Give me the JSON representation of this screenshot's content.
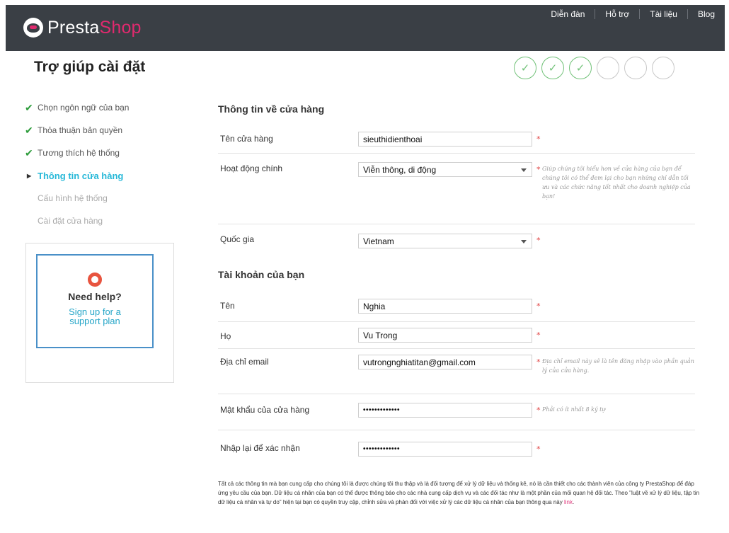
{
  "header": {
    "logo_part1": "Presta",
    "logo_part2": "Shop",
    "nav": [
      "Diễn đàn",
      "Hỗ trợ",
      "Tài liệu",
      "Blog"
    ]
  },
  "page": {
    "title": "Trợ giúp cài đặt"
  },
  "progress": {
    "total_steps": 6,
    "completed_steps": 3
  },
  "sidebar": {
    "items": [
      {
        "label": "Chọn ngôn ngữ của bạn",
        "state": "done"
      },
      {
        "label": "Thỏa thuận bản quyền",
        "state": "done"
      },
      {
        "label": "Tương thích hệ thống",
        "state": "done"
      },
      {
        "label": "Thông tin cửa hàng",
        "state": "active"
      },
      {
        "label": "Cấu hình hệ thống",
        "state": "pending"
      },
      {
        "label": "Cài đặt cửa hàng",
        "state": "pending"
      }
    ]
  },
  "help": {
    "title": "Need help?",
    "link_line1": "Sign up for a",
    "link_line2": "support plan"
  },
  "store": {
    "section_title": "Thông tin về cửa hàng",
    "name_label": "Tên cửa hàng",
    "name_value": "sieuthidienthoai",
    "activity_label": "Hoạt động chính",
    "activity_value": "Viễn thông, di động",
    "activity_hint": "Giúp chúng tôi hiểu hơn về cửa hàng của bạn để chúng tôi có thể đem lại cho bạn những chỉ dẫn tối ưu và các chức năng tốt nhất cho doanh nghiệp của bạn!",
    "country_label": "Quốc gia",
    "country_value": "Vietnam"
  },
  "account": {
    "section_title": "Tài khoản của bạn",
    "first_name_label": "Tên",
    "first_name_value": "Nghia",
    "last_name_label": "Họ",
    "last_name_value": "Vu Trong",
    "email_label": "Địa chỉ email",
    "email_value": "vutrongnghiatitan@gmail.com",
    "email_hint": "Địa chỉ email này sẽ là tên đăng nhập vào phần quản lý của cửa hàng.",
    "password_label": "Mật khẩu của cửa hàng",
    "password_value": "•••••••••••••",
    "password_hint": "Phải có ít nhất 8 ký tự",
    "confirm_label": "Nhập lại để xác nhận",
    "confirm_value": "•••••••••••••",
    "required_mark": "*"
  },
  "footer": {
    "text": "Tất cả các thông tin mà bạn cung cấp cho chúng tôi là được chúng tôi thu thập và là đối tượng để xử lý dữ liệu và thống kê, nó là cần thiết cho các thành viên của công ty PrestaShop để đáp ứng yêu cầu của bạn. Dữ liệu cá nhân của bạn có thể được thông báo cho các nhà cung cấp dịch vụ và các đối tác như là một phần của mối quan hệ đối tác. Theo \"luật về xử lý dữ liệu, tập tin dữ liệu cá nhân và tự do\" hiện tại bạn có quyền truy cập, chỉnh sửa và phản đối với việc xử lý các dữ liệu cá nhân của bạn thông qua này",
    "link_text": "link"
  },
  "colors": {
    "header_bg": "#3a3f45",
    "brand_pink": "#df2a6e",
    "active_blue": "#26b8d8",
    "done_green": "#72c279",
    "required_red": "#e04040"
  }
}
